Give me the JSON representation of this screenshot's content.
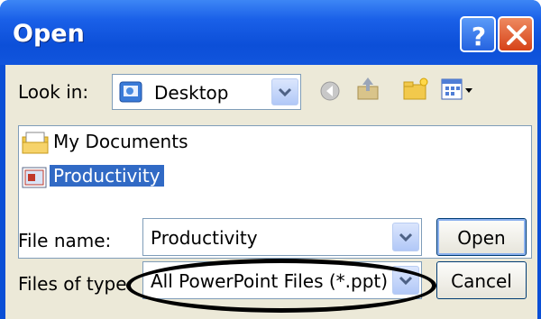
{
  "title": "Open",
  "title_buttons": {
    "help": "?",
    "close": "X"
  },
  "look_in": {
    "label": "Look in:",
    "value": "Desktop"
  },
  "toolbar": {
    "icons": [
      "back-icon",
      "up-folder-icon",
      "new-folder-icon",
      "views-menu-icon"
    ]
  },
  "files": [
    {
      "name": "My Documents",
      "icon": "my-documents-icon",
      "selected": false
    },
    {
      "name": "Productivity",
      "icon": "powerpoint-file-icon",
      "selected": true
    }
  ],
  "file_name": {
    "label": "File name:",
    "value": "Productivity"
  },
  "files_of_type": {
    "label": "Files of type:",
    "value": "All PowerPoint Files (*.ppt)"
  },
  "buttons": {
    "open": "Open",
    "cancel": "Cancel"
  },
  "colors": {
    "titlebar": "#0c4fd8",
    "selection": "#316ac5",
    "face": "#ece9d8",
    "annotation": "#000000"
  }
}
